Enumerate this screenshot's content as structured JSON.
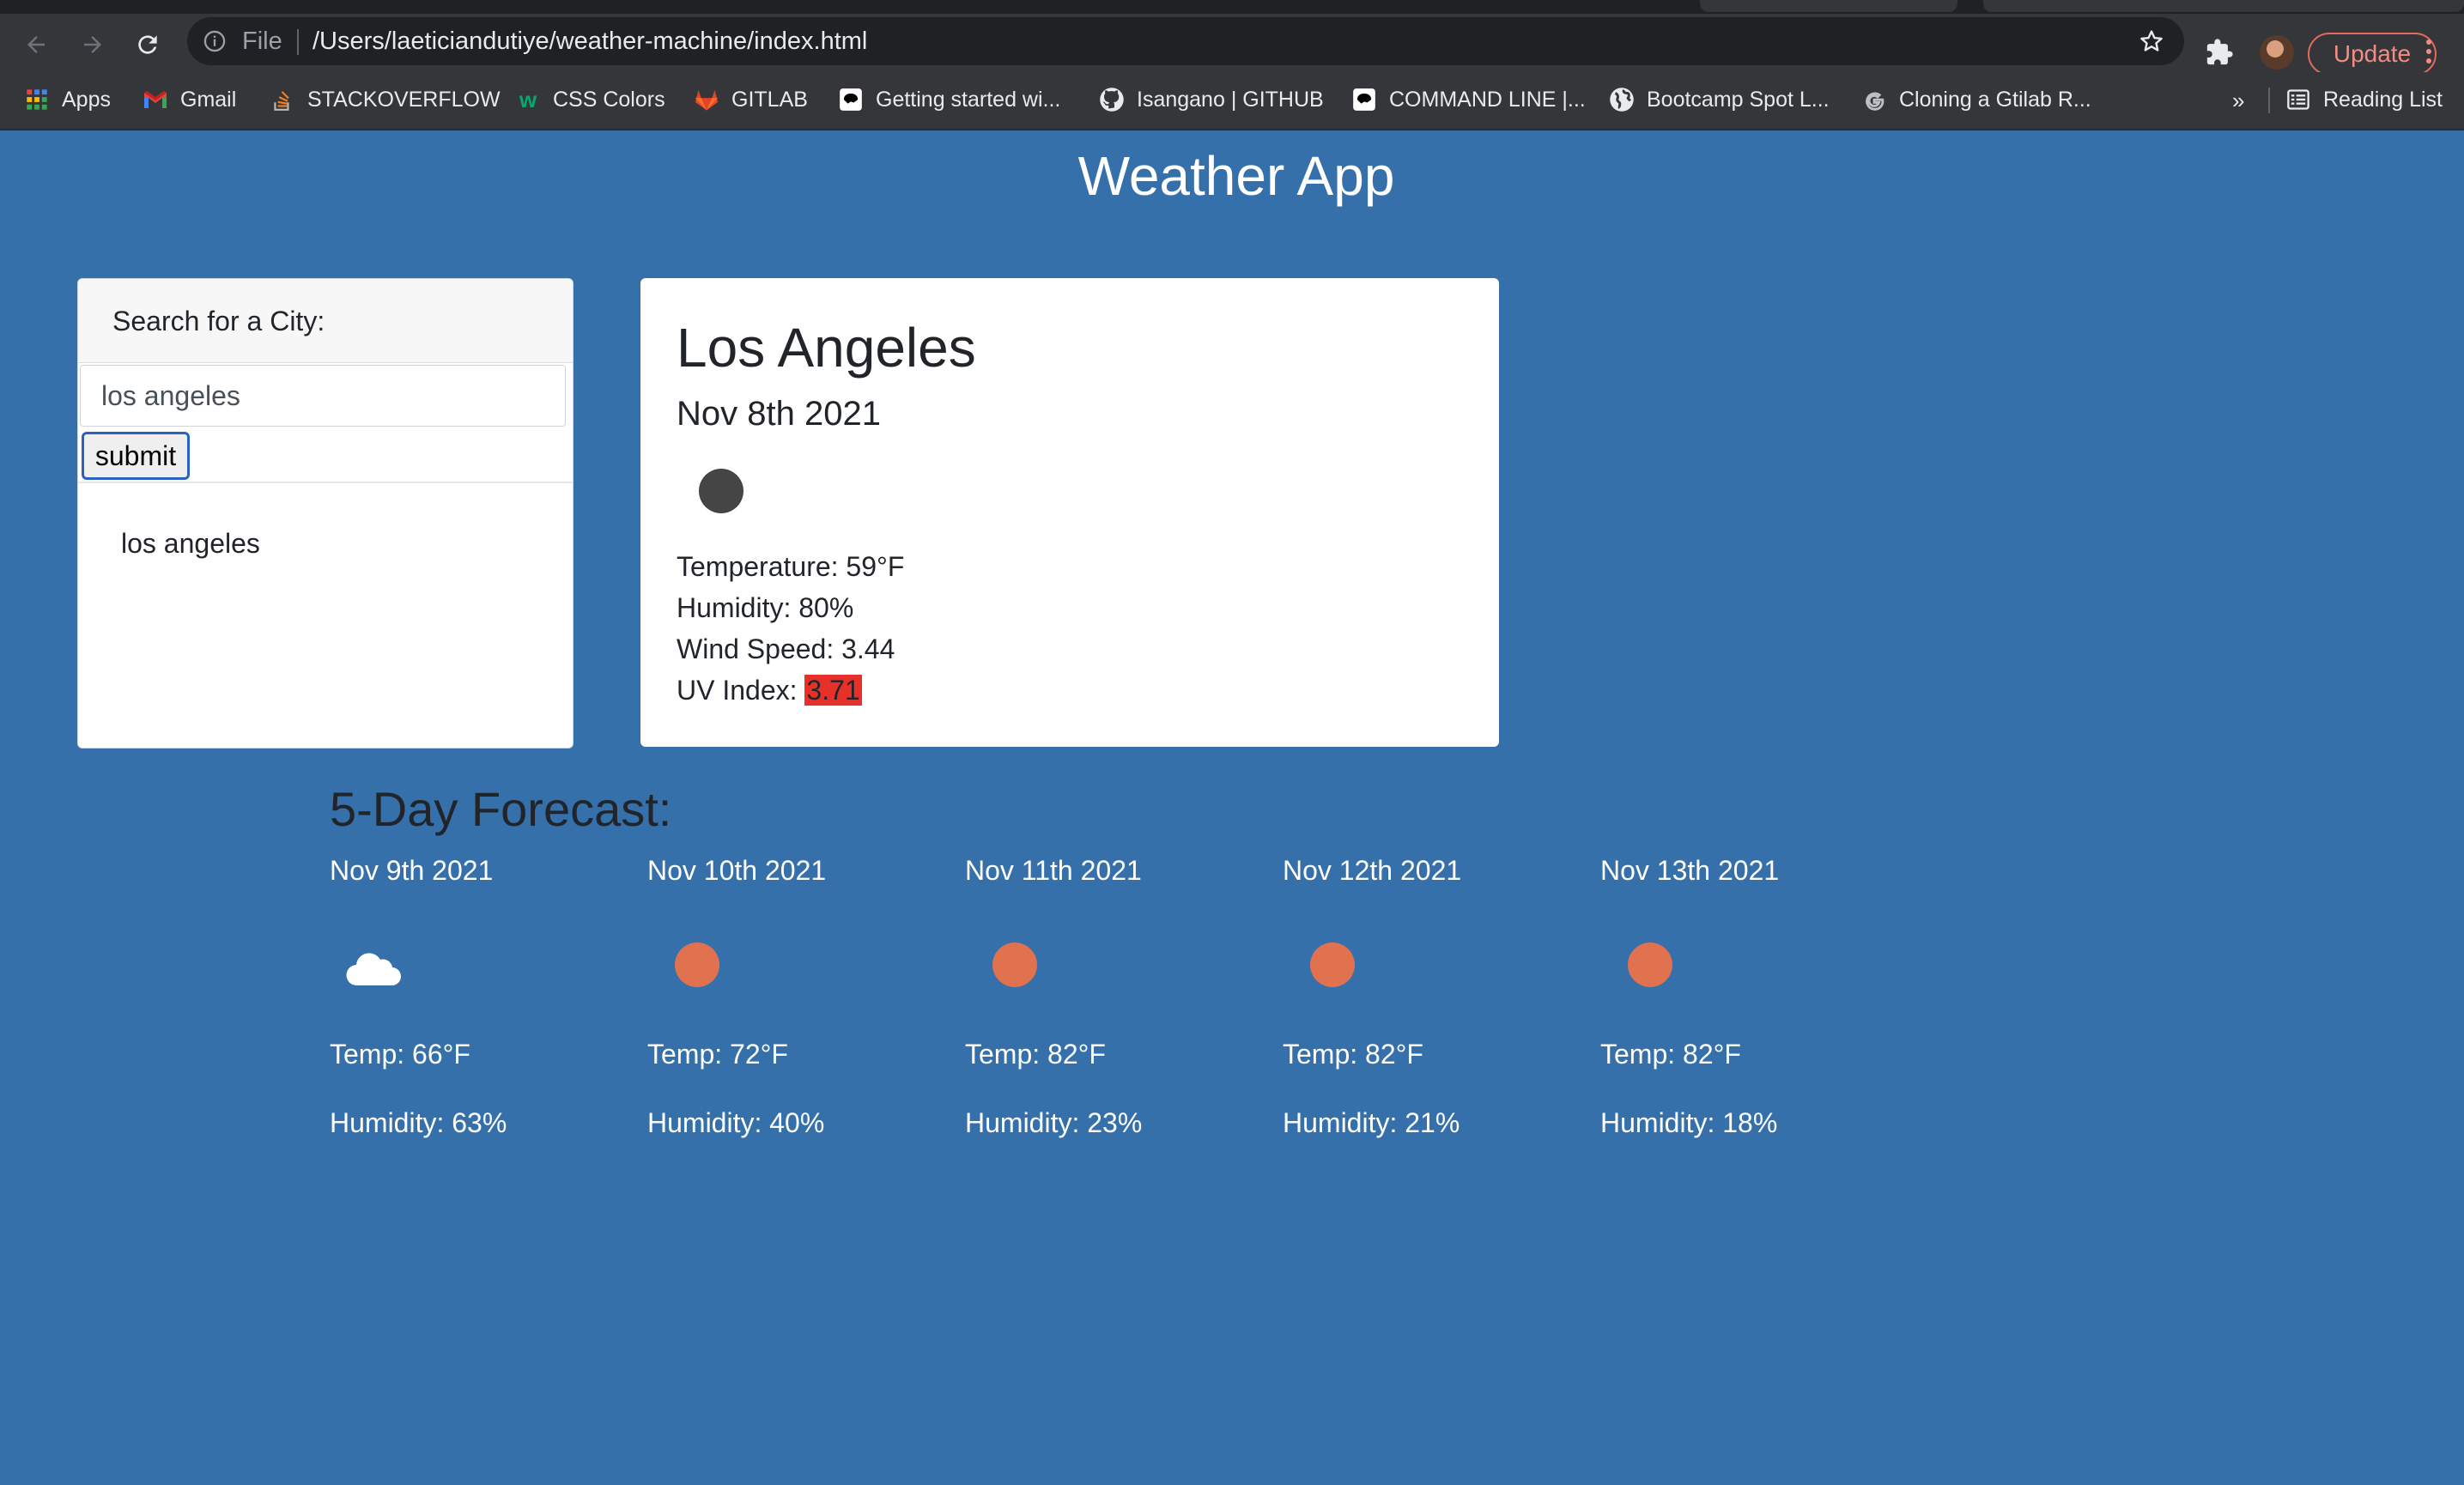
{
  "browser": {
    "address_scheme": "File",
    "url": "/Users/laeticiandutiye/weather-machine/index.html",
    "update_label": "Update",
    "bookmarks": [
      {
        "label": "Apps",
        "icon": "apps-grid-icon"
      },
      {
        "label": "Gmail",
        "icon": "gmail-icon"
      },
      {
        "label": "STACKOVERFLOW",
        "icon": "stackoverflow-icon"
      },
      {
        "label": "CSS Colors",
        "icon": "w3schools-icon"
      },
      {
        "label": "GITLAB",
        "icon": "gitlab-icon"
      },
      {
        "label": "Getting started wi...",
        "icon": "bootcamp-icon"
      },
      {
        "label": "Isangano | GITHUB",
        "icon": "github-icon"
      },
      {
        "label": "COMMAND LINE |...",
        "icon": "bootcamp-icon"
      },
      {
        "label": "Bootcamp Spot L...",
        "icon": "globe-icon"
      },
      {
        "label": "Cloning a Gtilab R...",
        "icon": "google-icon"
      }
    ],
    "more_label": "»",
    "reading_list_label": "Reading List"
  },
  "app": {
    "title": "Weather App"
  },
  "search": {
    "header": "Search for a City:",
    "input_value": "los angeles",
    "submit_label": "submit",
    "history": [
      "los angeles"
    ]
  },
  "current": {
    "city": "Los Angeles",
    "date": "Nov 8th 2021",
    "icon": "dark-circle-weather-icon",
    "temperature_label": "Temperature: 59°F",
    "humidity_label": "Humidity: 80%",
    "wind_label": "Wind Speed: 3.44",
    "uv_label": "UV Index: ",
    "uv_value": "3.71",
    "uv_color": "#e8302a"
  },
  "forecast": {
    "title": "5-Day Forecast:",
    "days": [
      {
        "date": "Nov 9th 2021",
        "icon": "cloud-icon",
        "temp": "Temp: 66°F",
        "humidity": "Humidity: 63%"
      },
      {
        "date": "Nov 10th 2021",
        "icon": "sun-icon",
        "temp": "Temp: 72°F",
        "humidity": "Humidity: 40%"
      },
      {
        "date": "Nov 11th 2021",
        "icon": "sun-icon",
        "temp": "Temp: 82°F",
        "humidity": "Humidity: 23%"
      },
      {
        "date": "Nov 12th 2021",
        "icon": "sun-icon",
        "temp": "Temp: 82°F",
        "humidity": "Humidity: 21%"
      },
      {
        "date": "Nov 13th 2021",
        "icon": "sun-icon",
        "temp": "Temp: 82°F",
        "humidity": "Humidity: 18%"
      }
    ]
  },
  "colors": {
    "page_background": "#3570ab",
    "sun": "#e0724f",
    "uv_high": "#e8302a"
  }
}
